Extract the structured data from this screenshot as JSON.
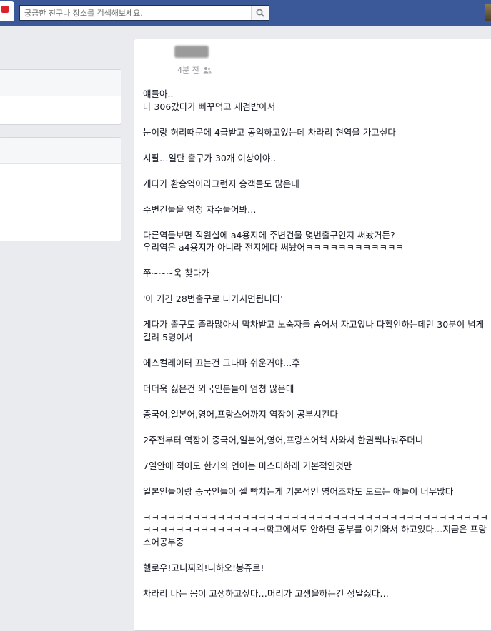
{
  "header": {
    "search_placeholder": "궁금한 친구나 장소를 검색해보세요."
  },
  "post": {
    "timestamp": "4분 전",
    "paragraphs": [
      "얘들아..\n나 306갔다가 빠꾸먹고 재검받아서",
      "눈이랑 허리때문에 4급받고 공익하고있는데 차라리 현역을 가고싶다",
      "시팔…일단 출구가 30개 이상이야..",
      "게다가 환승역이라그런지 승객들도 많은데",
      "주변건물을 엄청 자주물어봐…",
      "다른역들보면 직원실에 a4용지에 주변건물 몇번출구인지 써놨거든?\n우리역은 a4용지가 아니라 전지에다 써놨어ㅋㅋㅋㅋㅋㅋㅋㅋㅋㅋㅋㅋ",
      "쭈~~~욱 찾다가",
      "'아 거긴 28번출구로 나가시면됩니다'",
      "게다가 출구도 졸라많아서 막차받고 노숙자들 숨어서 자고있나 다확인하는데만 30분이 넘게걸려 5명이서",
      "에스컬레이터 끄는건 그나마 쉬운거야…후",
      "더더욱 싫은건 외국인분들이 엄청 많은데",
      "중국어,일본어,영어,프랑스어까지 역장이 공부시킨다",
      "2주전부터 역장이 중국어,일본어,영어,프랑스어책 사와서 한권씩나눠주더니",
      "7일안에 적어도 한개의 언어는 마스터하래 기본적인것만",
      "일본인들이랑 중국인들이 젤 빡치는게 기본적인 영어조차도 모르는 애들이 너무많다",
      "ㅋㅋㅋㅋㅋㅋㅋㅋㅋㅋㅋㅋㅋㅋㅋㅋㅋㅋㅋㅋㅋㅋㅋㅋㅋㅋㅋㅋㅋㅋㅋㅋㅋㅋㅋㅋㅋㅋㅋㅋㅋㅋㅋㅋㅋㅋㅋㅋㅋㅋㅋㅋㅋㅋㅋㅋㅋ학교에서도 안하던 공부를 여기와서 하고있다…지금은 프랑스어공부중",
      "헬로우!고니찌와!니하오!봉쥬르!",
      "차라리 나는 몸이 고생하고싶다…머리가 고생을하는건 정말싫다…"
    ]
  }
}
